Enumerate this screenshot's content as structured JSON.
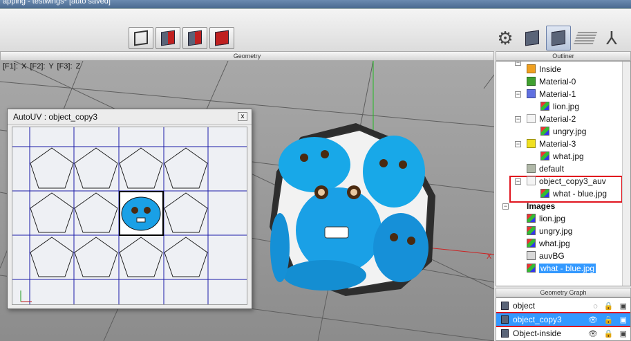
{
  "window": {
    "title_fragment": "apping - testwings* [auto saved]"
  },
  "toolbar": {
    "left_buttons": [
      "wireframe-cube",
      "half-shaded-cube",
      "shaded-cube",
      "solid-red-cube"
    ],
    "right_icons": [
      "gear-icon",
      "cube-shaded-icon",
      "cube-selected-icon",
      "grid-plane-icon",
      "axes-icon"
    ]
  },
  "geometry": {
    "title": "Geometry",
    "keys": "[F1]: X     [F2]: Y     [F3]: Z"
  },
  "autouv": {
    "title": "AutoUV : object_copy3",
    "close": "x"
  },
  "outliner": {
    "title": "Outliner",
    "items": [
      {
        "label": "Inside",
        "kind": "material",
        "color": "#f0a020"
      },
      {
        "label": "Material-0",
        "kind": "material",
        "color": "#40a030"
      },
      {
        "label": "Material-1",
        "kind": "material",
        "color": "#6070e0"
      },
      {
        "label": "lion.jpg",
        "kind": "image"
      },
      {
        "label": "Material-2",
        "kind": "material",
        "color": "#f4f4f4"
      },
      {
        "label": "ungry.jpg",
        "kind": "image"
      },
      {
        "label": "Material-3",
        "kind": "material",
        "color": "#f0e020"
      },
      {
        "label": "what.jpg",
        "kind": "image"
      },
      {
        "label": "default",
        "kind": "material",
        "color": "#b0b8a8"
      },
      {
        "label": "object_copy3_auv",
        "kind": "material",
        "color": "#f4f4f4"
      },
      {
        "label": "what - blue.jpg",
        "kind": "image"
      },
      {
        "label": "Images",
        "kind": "heading"
      },
      {
        "label": "lion.jpg",
        "kind": "image"
      },
      {
        "label": "ungry.jpg",
        "kind": "image"
      },
      {
        "label": "what.jpg",
        "kind": "image"
      },
      {
        "label": "auvBG",
        "kind": "image"
      },
      {
        "label": "what - blue.jpg",
        "kind": "image"
      }
    ]
  },
  "graph": {
    "title": "Geometry Graph",
    "items": [
      {
        "label": "object",
        "selected": false
      },
      {
        "label": "object_copy3",
        "selected": true
      },
      {
        "label": "Object-inside",
        "selected": false
      }
    ]
  }
}
